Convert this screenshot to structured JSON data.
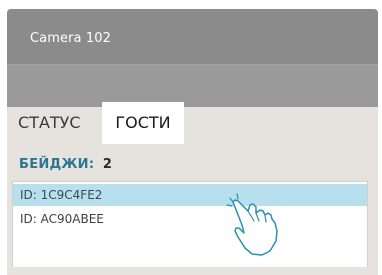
{
  "window": {
    "title": "Camera 102"
  },
  "tabs": [
    {
      "label": "СТАТУС",
      "active": false
    },
    {
      "label": "ГОСТИ",
      "active": true
    }
  ],
  "badges": {
    "label": "БЕЙДЖИ:",
    "count": "2"
  },
  "list": {
    "items": [
      {
        "label": "ID: 1C9C4FE2",
        "selected": true
      },
      {
        "label": "ID: AC90ABEE",
        "selected": false
      }
    ]
  },
  "colors": {
    "titlebar": "#8b8b8b",
    "toolbar": "#9a9a9a",
    "panel": "#e6e3df",
    "accent": "#2a7693",
    "selection": "#b7dfee"
  },
  "icons": {
    "pointer": "tap-hand-icon"
  }
}
